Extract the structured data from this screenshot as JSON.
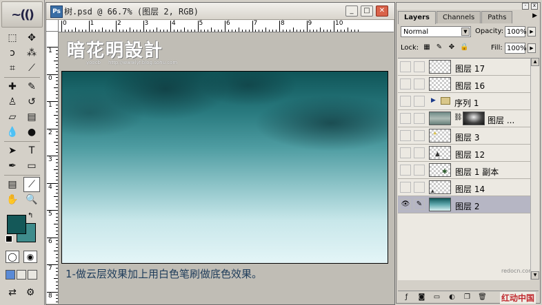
{
  "document": {
    "title": "树.psd @ 66.7% (图层 2, RGB)",
    "ruler_top": [
      "0",
      "1",
      "2",
      "3",
      "4",
      "5",
      "6",
      "7",
      "8",
      "9",
      "10"
    ],
    "ruler_left": [
      "1",
      "0",
      "1",
      "2",
      "3",
      "4",
      "5",
      "6",
      "7",
      "8"
    ]
  },
  "watermark": {
    "main": "暗花明設計",
    "sub": "yoocb",
    "url": "http://wwwlyf.blog.sohu.com"
  },
  "caption": "1-做云层效果加上用白色笔刷做底色效果。",
  "colors": {
    "foreground": "#145858",
    "background": "#3f8c8c"
  },
  "layers_panel": {
    "tabs": [
      "Layers",
      "Channels",
      "Paths"
    ],
    "blend_mode": "Normal",
    "opacity_label": "Opacity:",
    "opacity_value": "100%",
    "lock_label": "Lock:",
    "fill_label": "Fill:",
    "fill_value": "100%",
    "layers": [
      {
        "name": "图层 17"
      },
      {
        "name": "图层 16"
      },
      {
        "name": "序列 1"
      },
      {
        "name": "图层 ..."
      },
      {
        "name": "图层 3"
      },
      {
        "name": "图层 12"
      },
      {
        "name": "图层 1 副本"
      },
      {
        "name": "图层 14"
      },
      {
        "name": "图层 2"
      }
    ],
    "site_small": "redocn.com",
    "site_logo": "红动中国"
  }
}
